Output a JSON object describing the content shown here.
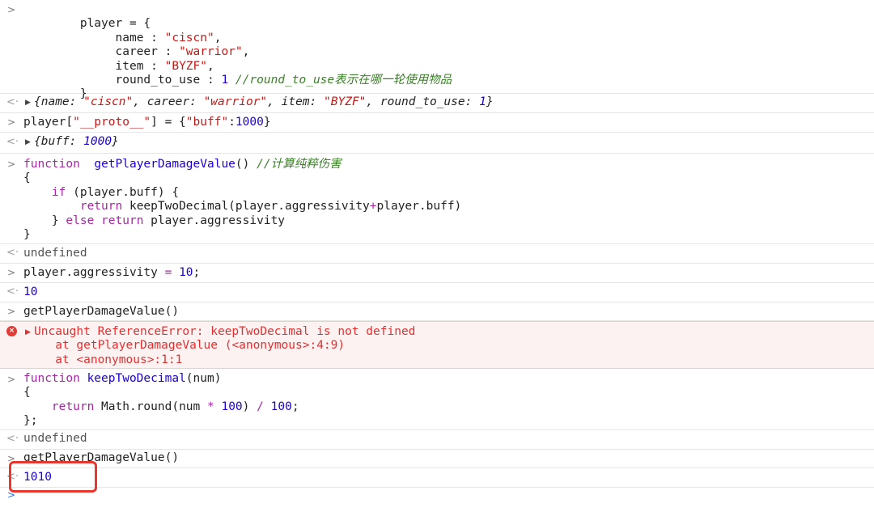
{
  "console": {
    "entry1": {
      "lines": [
        "player = {",
        "name : ",
        "\"ciscn\"",
        ",",
        "career : ",
        "\"warrior\"",
        ",",
        "item : ",
        "\"BYZF\"",
        ",",
        "round_to_use : ",
        "1",
        "//round_to_use表示在哪一轮使用物品",
        "}"
      ]
    },
    "result1": {
      "name_key": "name",
      "name_val": "\"ciscn\"",
      "career_key": "career",
      "career_val": "\"warrior\"",
      "item_key": "item",
      "item_val": "\"BYZF\"",
      "round_key": "round_to_use",
      "round_val": "1"
    },
    "entry2": {
      "left": "player[",
      "key": "\"__proto__\"",
      "mid": "] = {",
      "str": "\"buff\"",
      "colon": ":",
      "num": "1000",
      "end": "}"
    },
    "result2": {
      "key": "buff",
      "val": "1000"
    },
    "entry3": {
      "kw_function": "function",
      "fn_name": "getPlayerDamageValue",
      "parens": "()",
      "comment": "//计算纯粹伤害",
      "brace_open": "{",
      "kw_if": "if",
      "if_cond": " (player.buff) {",
      "kw_return": "return",
      "return_expr1": " keepTwoDecimal(player.aggressivity",
      "plus": "+",
      "return_expr2": "player.buff)",
      "else_prefix": "} ",
      "kw_else": "else",
      "kw_return2": "return",
      "else_expr": " player.aggressivity",
      "brace_close": "}"
    },
    "result3": "undefined",
    "entry4": {
      "lhs": "player.aggressivity",
      "eq": " = ",
      "num": "10",
      "semi": ";"
    },
    "result4": "10",
    "entry5": "getPlayerDamageValue()",
    "error": {
      "line1": "Uncaught ReferenceError: keepTwoDecimal is not defined",
      "line2": "at getPlayerDamageValue (<anonymous>:4:9)",
      "line3": "at <anonymous>:1:1"
    },
    "entry6": {
      "kw_function": "function",
      "fn_name": "keepTwoDecimal",
      "params": "(num)",
      "brace_open": "{",
      "kw_return": "return",
      "expr1": " Math.round(num ",
      "star": "*",
      "num100": "100",
      "expr2": ") ",
      "slash": "/",
      "num100b": "100",
      "semi": ";",
      "brace_close": "};"
    },
    "result6": "undefined",
    "entry7": "getPlayerDamageValue()",
    "result7": "1010"
  },
  "prompts": {
    "input": ">",
    "output": "<·",
    "error_icon": "×"
  },
  "colors": {
    "highlight": "#e8372e",
    "error": "#e03131",
    "keyword": "#a626a4",
    "string": "#c41a16",
    "number": "#1c00cf",
    "comment": "#3b8227"
  }
}
